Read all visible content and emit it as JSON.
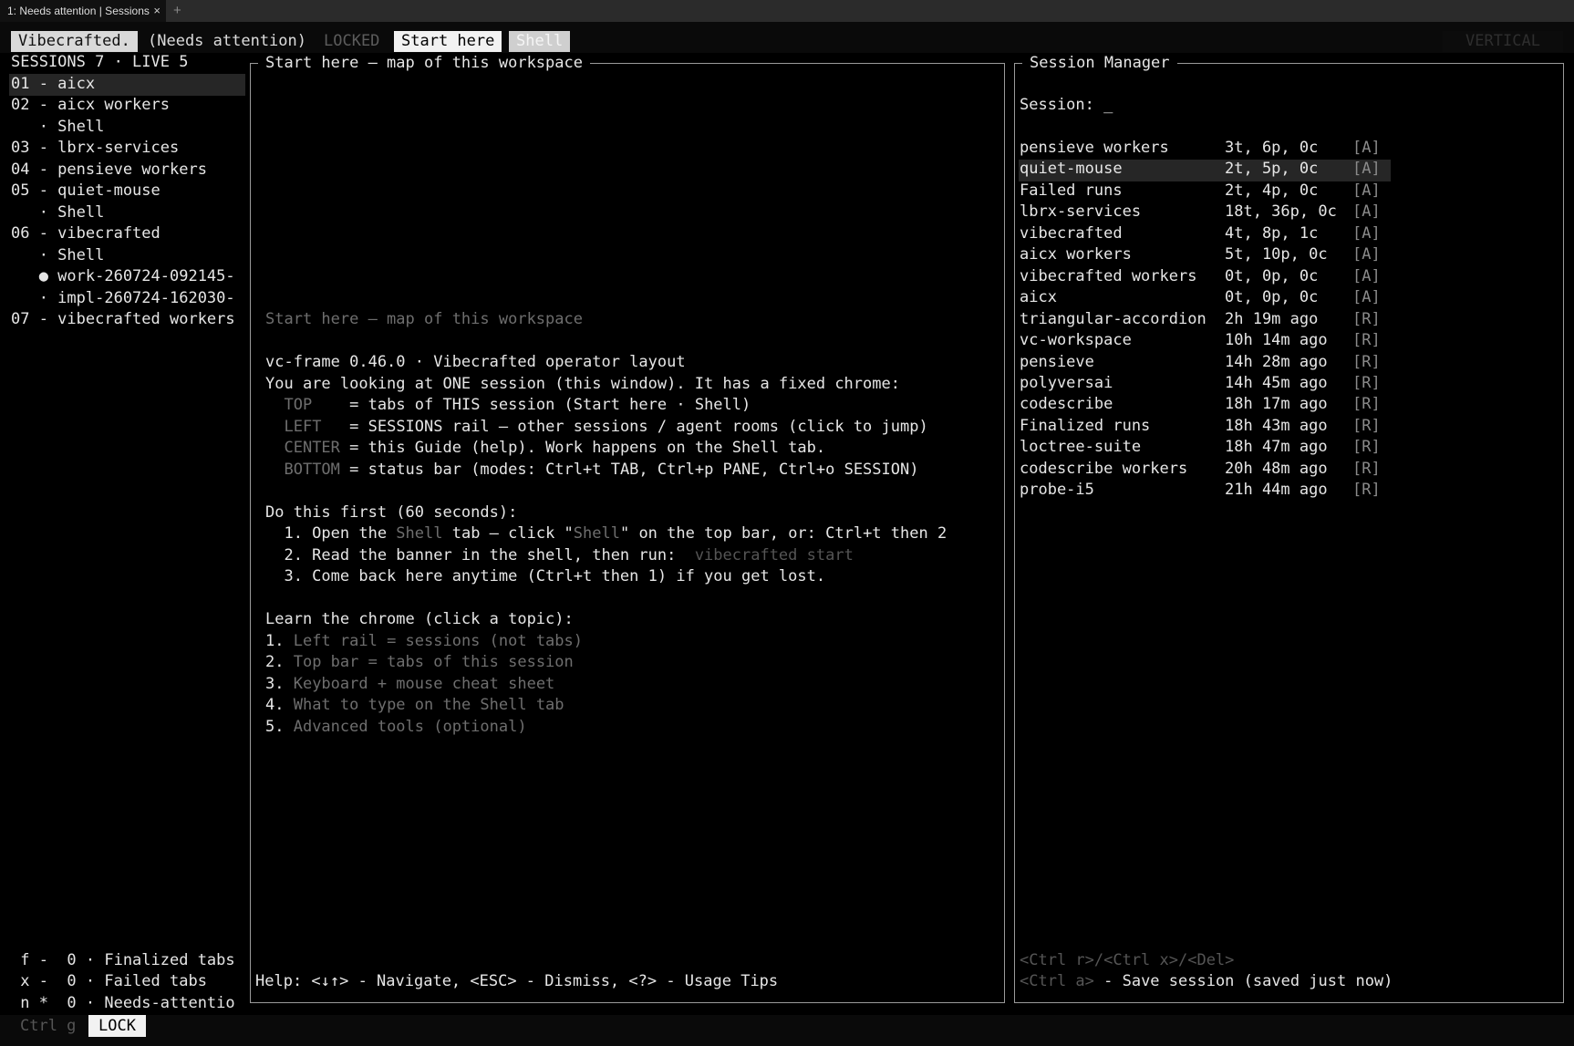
{
  "window_tab": {
    "title": "1: Needs attention | Sessions",
    "close_icon": "×",
    "new_tab_icon": "+"
  },
  "topbar": {
    "name": "Vibecrafted.",
    "status": "(Needs attention)",
    "locked": "LOCKED",
    "tabs": [
      "Start here",
      "Shell"
    ],
    "layout": "VERTICAL"
  },
  "sidebar": {
    "header": "SESSIONS 7 · LIVE 5",
    "items": [
      "01 - aicx",
      "02 - aicx workers",
      "   · Shell",
      "03 - lbrx-services",
      "04 - pensieve workers",
      "05 - quiet-mouse",
      "   · Shell",
      "06 - vibecrafted",
      "   · Shell",
      "   ● work-260724-092145-",
      "   · impl-260724-162030-",
      "07 - vibecrafted workers"
    ],
    "footer": [
      " f -  0 · Finalized tabs",
      " x -  0 · Failed tabs",
      " n *  0 · Needs-attentio"
    ]
  },
  "guide": {
    "title": "Start here — map of this workspace",
    "heading_dim": "Start here — map of this workspace",
    "version": "vc-frame 0.46.0 · Vibecrafted operator layout",
    "intro": "You are looking at ONE session (this window). It has a fixed chrome:",
    "chrome": [
      {
        "key": "TOP   ",
        "desc": " = tabs of THIS session (Start here · Shell)"
      },
      {
        "key": "LEFT  ",
        "desc": " = SESSIONS rail — other sessions / agent rooms (click to jump)"
      },
      {
        "key": "CENTER",
        "desc": " = this Guide (help). Work happens on the Shell tab."
      },
      {
        "key": "BOTTOM",
        "desc": " = status bar (modes: Ctrl+t TAB, Ctrl+p PANE, Ctrl+o SESSION)"
      }
    ],
    "first_heading": "Do this first (60 seconds):",
    "step1_a": "  1. Open the ",
    "step1_b": "Shell",
    "step1_c": " tab — click \"",
    "step1_d": "Shell",
    "step1_e": "\" on the top bar, or: Ctrl+t then 2",
    "step2_a": "  2. Read the banner in the shell, then run:  ",
    "step2_b": "vibecrafted start",
    "step3": "  3. Come back here anytime (Ctrl+t then 1) if you get lost.",
    "learn_heading": "Learn the chrome (click a topic):",
    "topics": [
      {
        "num": "1. ",
        "label": "Left rail = sessions (not tabs)"
      },
      {
        "num": "2. ",
        "label": "Top bar = tabs of this session"
      },
      {
        "num": "3. ",
        "label": "Keyboard + mouse cheat sheet"
      },
      {
        "num": "4. ",
        "label": "What to type on the Shell tab"
      },
      {
        "num": "5. ",
        "label": "Advanced tools (optional)"
      }
    ],
    "help": "Help: <↓↑> - Navigate, <ESC> - Dismiss, <?> - Usage Tips"
  },
  "session_manager": {
    "title": "Session Manager",
    "prompt": "Session: _",
    "sessions": [
      {
        "name": "pensieve workers",
        "stat": "3t, 6p, 0c",
        "tag": "[A]"
      },
      {
        "name": "quiet-mouse",
        "stat": "2t, 5p, 0c",
        "tag": "[A]"
      },
      {
        "name": "Failed runs",
        "stat": "2t, 4p, 0c",
        "tag": "[A]"
      },
      {
        "name": "lbrx-services",
        "stat": "18t, 36p, 0c",
        "tag": "[A]"
      },
      {
        "name": "vibecrafted",
        "stat": "4t, 8p, 1c",
        "tag": "[A]"
      },
      {
        "name": "aicx workers",
        "stat": "5t, 10p, 0c",
        "tag": "[A]"
      },
      {
        "name": "vibecrafted workers",
        "stat": "0t, 0p, 0c",
        "tag": "[A]"
      },
      {
        "name": "aicx",
        "stat": "0t, 0p, 0c",
        "tag": "[A]"
      },
      {
        "name": "triangular-accordion",
        "stat": "2h 19m ago",
        "tag": "[R]"
      },
      {
        "name": "vc-workspace",
        "stat": "10h 14m ago",
        "tag": "[R]"
      },
      {
        "name": "pensieve",
        "stat": "14h 28m ago",
        "tag": "[R]"
      },
      {
        "name": "polyversai",
        "stat": "14h 45m ago",
        "tag": "[R]"
      },
      {
        "name": "codescribe",
        "stat": "18h 17m ago",
        "tag": "[R]"
      },
      {
        "name": "Finalized runs",
        "stat": "18h 43m ago",
        "tag": "[R]"
      },
      {
        "name": "loctree-suite",
        "stat": "18h 47m ago",
        "tag": "[R]"
      },
      {
        "name": "codescribe workers",
        "stat": "20h 48m ago",
        "tag": "[R]"
      },
      {
        "name": "probe-i5",
        "stat": "21h 44m ago",
        "tag": "[R]"
      }
    ],
    "keys_hint": "<Ctrl r>/<Ctrl x>/<Del>",
    "save_key": "<Ctrl a>",
    "save_text": " - Save session (saved just now)"
  },
  "statusbar": {
    "mode_key": "Ctrl g",
    "mode": "LOCK"
  },
  "colors": {
    "bg": "#000000",
    "fg": "#e6e6e6",
    "dim": "#6e6e6e",
    "border": "#9a9a9a"
  }
}
